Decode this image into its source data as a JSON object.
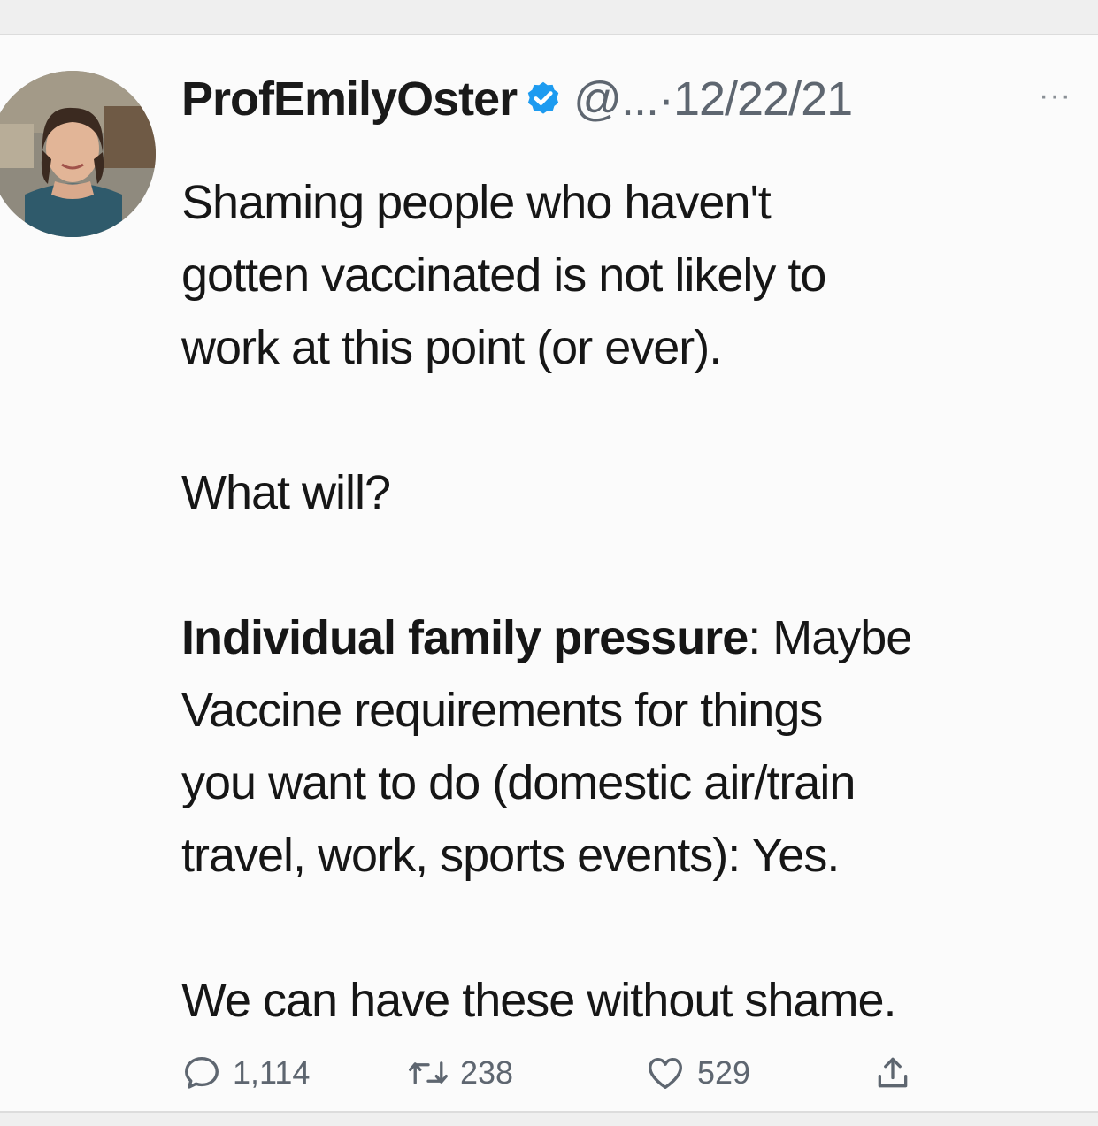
{
  "tweet": {
    "display_name": "ProfEmilyOster",
    "handle": "@...",
    "separator": "·",
    "date": "12/22/21",
    "more_glyph": "···",
    "body": {
      "line1": "Shaming people who haven't",
      "line2": "gotten vaccinated is not likely to",
      "line3": "work at this point (or ever).",
      "line4": "What will?",
      "line5_bold": "Individual family pressure",
      "line5_rest": ": Maybe",
      "line6": "Vaccine requirements for things",
      "line7": "you want to do (domestic air/train",
      "line8": "travel, work, sports events): Yes.",
      "line9": "We can have these without shame."
    },
    "metrics": {
      "replies": "1,114",
      "retweets": "238",
      "likes": "529"
    }
  },
  "colors": {
    "verified_badge": "#1d9bf0",
    "secondary_text": "#5e6670",
    "card_background": "#fbfbfb"
  },
  "icons": [
    "verified-badge-icon",
    "more-icon",
    "reply-icon",
    "retweet-icon",
    "like-icon",
    "share-icon"
  ]
}
